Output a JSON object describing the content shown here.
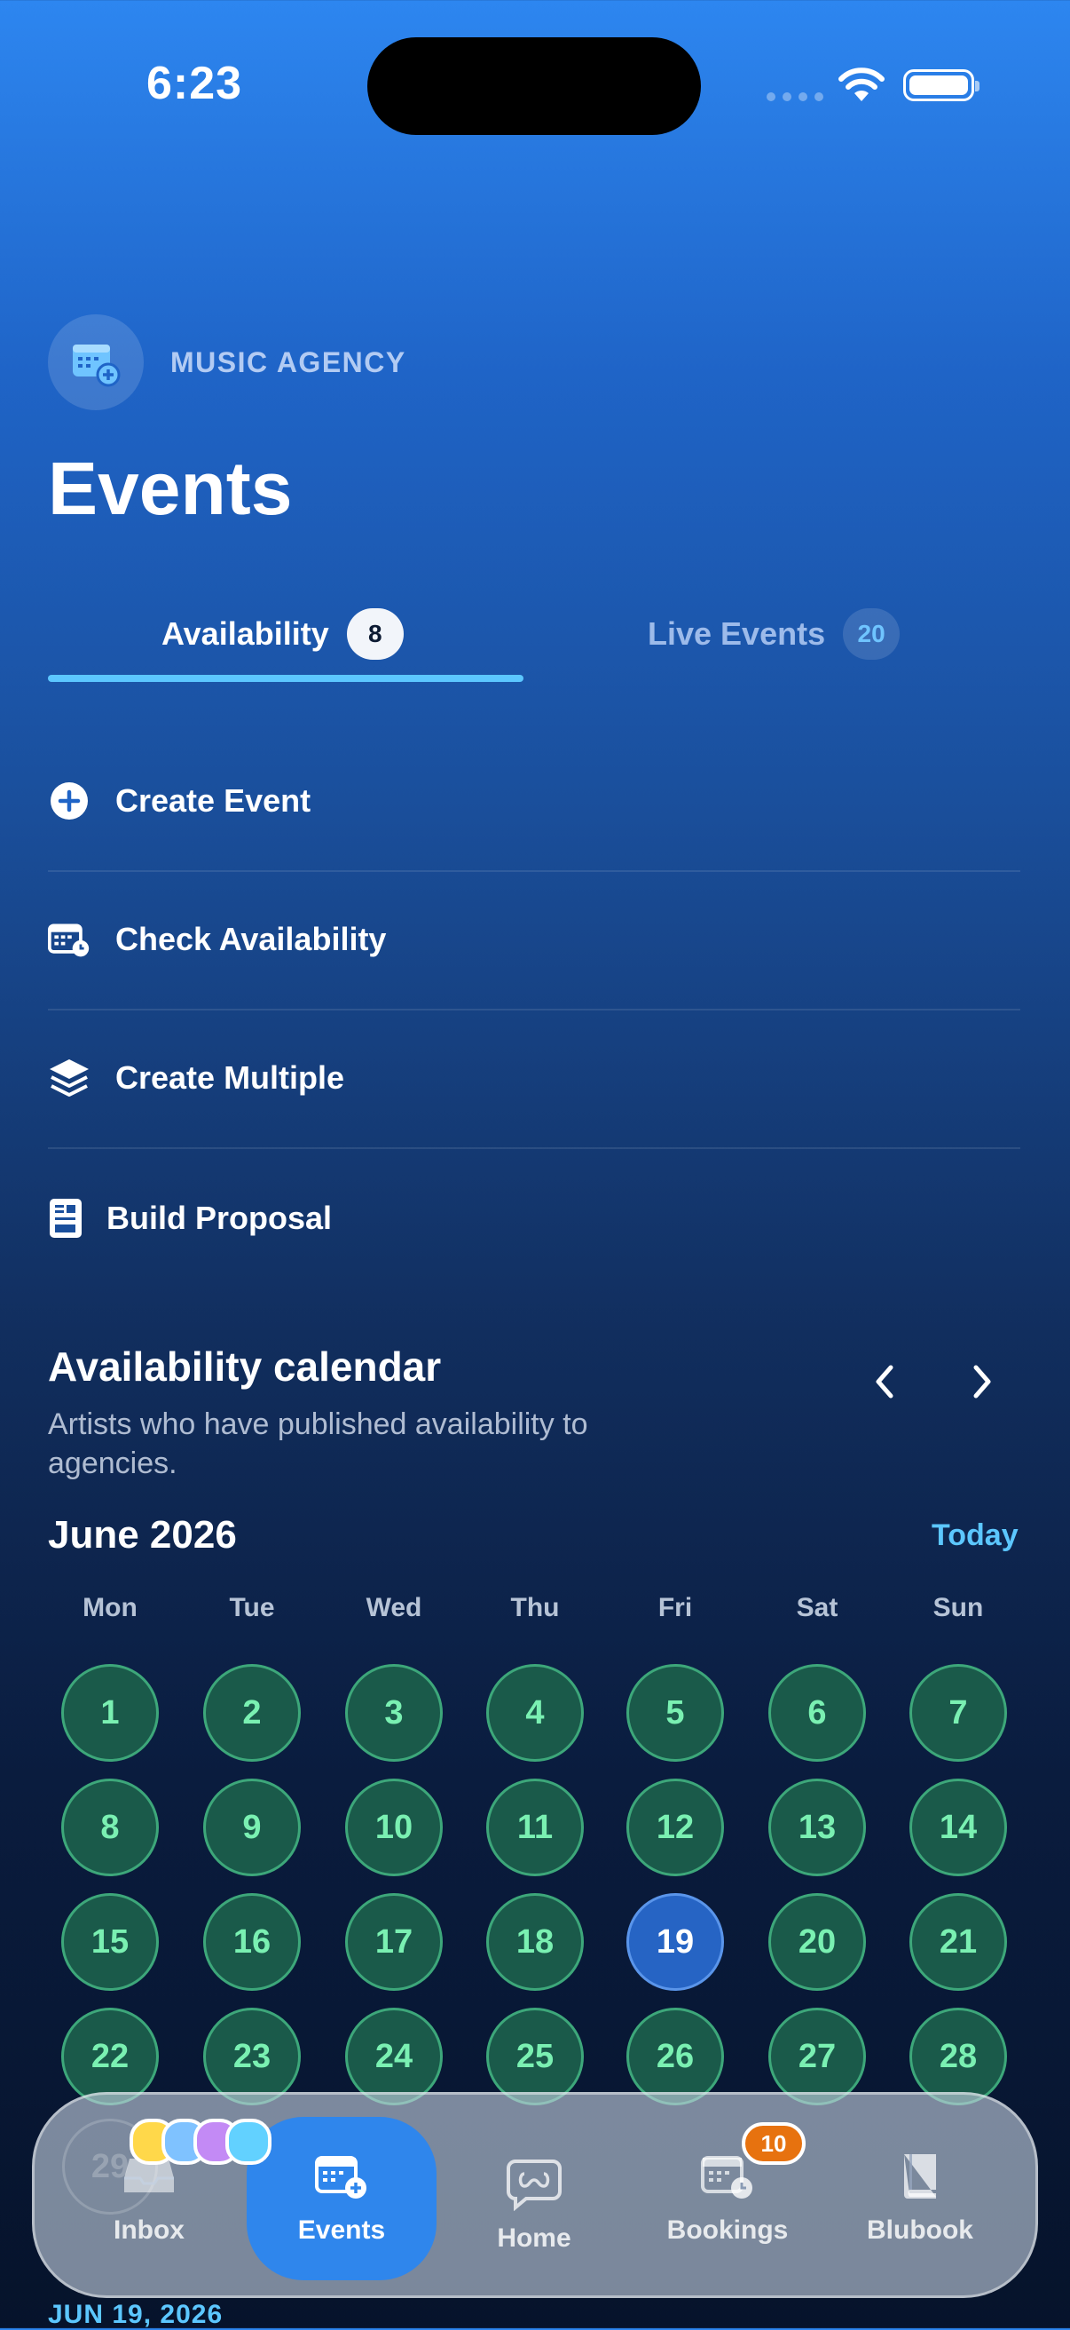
{
  "status_bar": {
    "time": "6:23"
  },
  "header": {
    "agency_label": "MUSIC AGENCY",
    "title": "Events"
  },
  "tabs": [
    {
      "label": "Availability",
      "count": "8",
      "active": true
    },
    {
      "label": "Live Events",
      "count": "20",
      "active": false
    }
  ],
  "actions": [
    {
      "label": "Create Event",
      "icon": "plus-circle-icon"
    },
    {
      "label": "Check Availability",
      "icon": "calendar-clock-icon"
    },
    {
      "label": "Create Multiple",
      "icon": "layers-icon"
    },
    {
      "label": "Build Proposal",
      "icon": "document-icon"
    }
  ],
  "calendar": {
    "title": "Availability calendar",
    "subtitle": "Artists who have published availability to agencies.",
    "month": "June 2026",
    "today_label": "Today",
    "weekdays": [
      "Mon",
      "Tue",
      "Wed",
      "Thu",
      "Fri",
      "Sat",
      "Sun"
    ],
    "days": [
      "1",
      "2",
      "3",
      "4",
      "5",
      "6",
      "7",
      "8",
      "9",
      "10",
      "11",
      "12",
      "13",
      "14",
      "15",
      "16",
      "17",
      "18",
      "19",
      "20",
      "21",
      "22",
      "23",
      "24",
      "25",
      "26",
      "27",
      "28"
    ],
    "selected_day": "19",
    "next_row_partial": "29",
    "selected_date_label": "JUN 19, 2026",
    "colors": {
      "available_fill": "#1a5a4a",
      "available_text": "#7af0b2",
      "selected_fill": "#2664c4"
    }
  },
  "bottom_nav": {
    "items": [
      {
        "label": "Inbox",
        "icon": "inbox-icon"
      },
      {
        "label": "Events",
        "icon": "calendar-plus-icon",
        "active": true
      },
      {
        "label": "Home",
        "icon": "chat-logo-icon"
      },
      {
        "label": "Bookings",
        "icon": "calendar-clock-icon",
        "badge": "10"
      },
      {
        "label": "Blubook",
        "icon": "book-icon"
      }
    ],
    "avatar_colors": [
      "#ffd84a",
      "#7fc2ff",
      "#c38af5",
      "#62d1ff"
    ]
  }
}
